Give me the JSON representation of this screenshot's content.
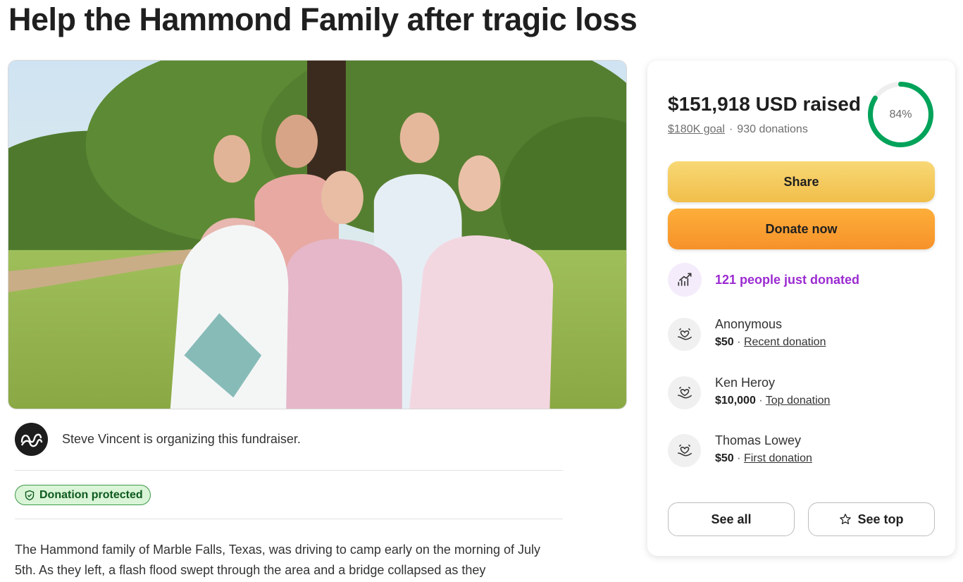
{
  "page": {
    "title": "Help the Hammond Family after tragic loss"
  },
  "hero": {
    "alt": "Photo of the Hammond family standing together outdoors under a tree"
  },
  "organizer": {
    "text": "Steve Vincent is organizing this fundraiser.",
    "avatar_icon": "sv-initials-logo"
  },
  "protection": {
    "label": "Donation protected",
    "icon": "shield-check-icon"
  },
  "story": {
    "text": "The Hammond family of Marble Falls, Texas, was driving to camp early on the morning of July 5th. As they left, a flash flood swept through the area and a bridge collapsed as they"
  },
  "donation_card": {
    "raised_text": "$151,918 USD raised",
    "goal_link": "$180K goal",
    "separator": "·",
    "donations_count": "930 donations",
    "progress": 0.84,
    "progress_label": "84%",
    "progress_color": "#01a35a",
    "share_label": "Share",
    "donate_label": "Donate now",
    "trend_text": "121 people just donated",
    "trend_color": "#9b2bd1",
    "donors": [
      {
        "name": "Anonymous",
        "amount": "$50",
        "sep": "·",
        "tag": "Recent donation"
      },
      {
        "name": "Ken Heroy",
        "amount": "$10,000",
        "sep": "·",
        "tag": "Top donation"
      },
      {
        "name": "Thomas Lowey",
        "amount": "$50",
        "sep": "·",
        "tag": "First donation"
      }
    ],
    "see_all_label": "See all",
    "see_top_label": "See top"
  }
}
